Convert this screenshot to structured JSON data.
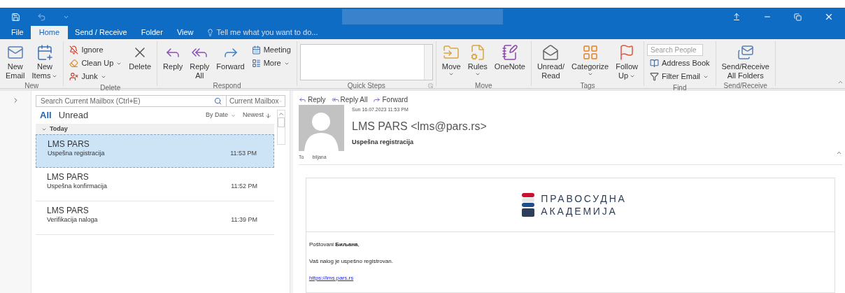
{
  "tabs": [
    {
      "label": "File",
      "selected": false
    },
    {
      "label": "Home",
      "selected": true
    },
    {
      "label": "Send / Receive",
      "selected": false
    },
    {
      "label": "Folder",
      "selected": false
    },
    {
      "label": "View",
      "selected": false
    }
  ],
  "tell_me": "Tell me what you want to do...",
  "ribbon": {
    "groups": [
      {
        "label": "New",
        "launcher": false,
        "items": [
          {
            "kind": "large",
            "label": "New\nEmail",
            "dropdown": false
          },
          {
            "kind": "large",
            "label": "New\nItems",
            "dropdown": true
          }
        ]
      },
      {
        "label": "Delete",
        "launcher": false,
        "items": [
          {
            "kind": "small",
            "label": "Ignore",
            "dropdown": false
          },
          {
            "kind": "small",
            "label": "Clean Up",
            "dropdown": true
          },
          {
            "kind": "small",
            "label": "Junk",
            "dropdown": true
          },
          {
            "kind": "large",
            "label": "Delete",
            "dropdown": false
          }
        ]
      },
      {
        "label": "Respond",
        "launcher": false,
        "items": [
          {
            "kind": "large",
            "label": "Reply",
            "dropdown": false
          },
          {
            "kind": "large",
            "label": "Reply\nAll",
            "dropdown": false
          },
          {
            "kind": "large",
            "label": "Forward",
            "dropdown": false
          },
          {
            "kind": "small",
            "label": "Meeting",
            "dropdown": false
          },
          {
            "kind": "small",
            "label": "More",
            "dropdown": true
          }
        ]
      },
      {
        "label": "Quick Steps",
        "launcher": true,
        "items": [
          {
            "kind": "gallery"
          }
        ]
      },
      {
        "label": "Move",
        "launcher": false,
        "items": [
          {
            "kind": "large",
            "label": "Move",
            "dropdown": true
          },
          {
            "kind": "large",
            "label": "Rules",
            "dropdown": true
          },
          {
            "kind": "large",
            "label": "OneNote",
            "dropdown": false
          }
        ]
      },
      {
        "label": "Tags",
        "launcher": false,
        "items": [
          {
            "kind": "large",
            "label": "Unread/\nRead",
            "dropdown": false
          },
          {
            "kind": "large",
            "label": "Categorize",
            "dropdown": true
          },
          {
            "kind": "large",
            "label": "Follow\nUp",
            "dropdown": true
          }
        ]
      },
      {
        "label": "Find",
        "launcher": false,
        "items": [
          {
            "kind": "search",
            "placeholder": "Search People"
          },
          {
            "kind": "small",
            "label": "Address Book",
            "dropdown": false
          },
          {
            "kind": "small",
            "label": "Filter Email",
            "dropdown": true
          }
        ]
      },
      {
        "label": "Send/Receive",
        "launcher": false,
        "items": [
          {
            "kind": "large",
            "label": "Send/Receive\nAll Folders",
            "dropdown": false
          }
        ]
      }
    ]
  },
  "mail_list": {
    "search": {
      "placeholder": "Search Current Mailbox (Ctrl+E)"
    },
    "scope": "Current Mailbox",
    "filters": [
      {
        "label": "All",
        "selected": true
      },
      {
        "label": "Unread",
        "selected": false
      }
    ],
    "sort": "By Date",
    "order": "Newest",
    "group": {
      "label": "Today",
      "expanded": true
    },
    "messages": [
      {
        "sender": "LMS PARS",
        "subject": "Uspešna registracija",
        "time": "11:53 PM",
        "selected": true
      },
      {
        "sender": "LMS PARS",
        "subject": "Uspešna konfirmacija",
        "time": "11:52 PM",
        "selected": false
      },
      {
        "sender": "LMS PARS",
        "subject": "Verifikacija naloga",
        "time": "11:39 PM",
        "selected": false
      }
    ]
  },
  "reading_pane": {
    "actions": [
      "Reply",
      "Reply All",
      "Forward"
    ],
    "date": "Sun 16.07.2023 11:53 PM",
    "from": "LMS PARS <lms@pars.rs>",
    "subject": "Uspešna registracija",
    "to_label": "To",
    "to": "biljana",
    "body": {
      "logo": [
        "ПРАВОСУДНА",
        "АКАДЕМИЈА"
      ],
      "greeting": "Poštovani **Биљана**,",
      "text": "Vaš nalog je uspešno registrovan.",
      "link": "https://lms.pars.rs"
    }
  }
}
